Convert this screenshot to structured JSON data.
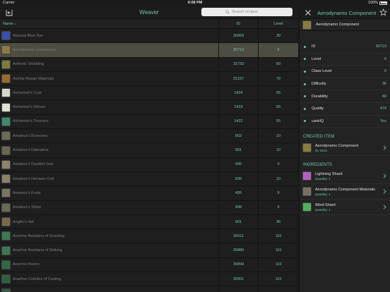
{
  "status_bar": {
    "carrier": "Carrier",
    "time": "4:08 PM",
    "battery": "100%"
  },
  "list": {
    "title": "Weaver",
    "search_placeholder": "Search recipes",
    "columns": {
      "name": "Name ↓",
      "id": "ID",
      "level": "Level"
    },
    "rows": [
      {
        "name": "Abyssal Blue Dye",
        "id": "30069",
        "level": "30",
        "icon_color": "#3a4fa8",
        "selected": false
      },
      {
        "name": "Aerodynamo Component",
        "id": "30719",
        "level": "6",
        "icon_color": "#8a7a40",
        "selected": true
      },
      {
        "name": "Aetheric Shielding",
        "id": "31733",
        "level": "50",
        "icon_color": "#7d7a3e",
        "selected": false
      },
      {
        "name": "Airship Repair Materials",
        "id": "31157",
        "level": "70",
        "icon_color": "#9a6a2a",
        "selected": false
      },
      {
        "name": "Alchemist's Coat",
        "id": "1424",
        "level": "55",
        "icon_color": "#d8d8c8",
        "selected": false
      },
      {
        "name": "Alchemist's Gloves",
        "id": "1423",
        "level": "55",
        "icon_color": "#e0e0d0",
        "selected": false
      },
      {
        "name": "Alchemist's Trousers",
        "id": "1422",
        "level": "55",
        "icon_color": "#3c8a6a",
        "selected": false
      },
      {
        "name": "Amateur's Breeches",
        "id": "502",
        "level": "10",
        "icon_color": "#6e6a58",
        "selected": false
      },
      {
        "name": "Amateur's Dalmatica",
        "id": "501",
        "level": "10",
        "icon_color": "#6a6650",
        "selected": false
      },
      {
        "name": "Amateur's Doublet Vest",
        "id": "496",
        "level": "9",
        "icon_color": "#8a8470",
        "selected": false
      },
      {
        "name": "Amateur's Hempen Coif",
        "id": "500",
        "level": "10",
        "icon_color": "#8c8068",
        "selected": false
      },
      {
        "name": "Amateur's Kurta",
        "id": "495",
        "level": "9",
        "icon_color": "#7a7460",
        "selected": false
      },
      {
        "name": "Amateur's Slops",
        "id": "498",
        "level": "9",
        "icon_color": "#6c6854",
        "selected": false
      },
      {
        "name": "Angler's Hat",
        "id": "601",
        "level": "36",
        "icon_color": "#7a6a4a",
        "selected": false
      },
      {
        "name": "Arachne Bandana of Scouting",
        "id": "30911",
        "level": "110",
        "icon_color": "#3c7a50",
        "selected": false
      },
      {
        "name": "Arachne Bandana of Striking",
        "id": "30880",
        "level": "110",
        "icon_color": "#3a7850",
        "selected": false
      },
      {
        "name": "Arachne Bolero",
        "id": "30899",
        "level": "110",
        "icon_color": "#2e6a48",
        "selected": false
      },
      {
        "name": "Arachne Culottes of Casting",
        "id": "30901",
        "level": "110",
        "icon_color": "#2c6040",
        "selected": false
      },
      {
        "name": "",
        "id": "",
        "level": "",
        "icon_color": "#2e5e40",
        "selected": false
      }
    ]
  },
  "detail": {
    "title": "Aerodynamo Component",
    "header_name": "Aerodynamo Component",
    "header_icon_color": "#8a7a40",
    "properties": [
      {
        "key": "ID",
        "value": "30719"
      },
      {
        "key": "Level",
        "value": "6"
      },
      {
        "key": "Class Level",
        "value": "6"
      },
      {
        "key": "Difficulty",
        "value": "36"
      },
      {
        "key": "Durability",
        "value": "60"
      },
      {
        "key": "Quality",
        "value": "474"
      },
      {
        "key": "canHQ",
        "value": "Yes"
      }
    ],
    "created_item_section": "CREATED ITEM",
    "created_item": {
      "name": "Aerodynamo Component",
      "sub": "ID: 8104",
      "icon_color": "#8a7a40"
    },
    "ingredients_section": "INGREDIENTS",
    "ingredients": [
      {
        "name": "Lightning Shard",
        "sub": "Quantity: 1",
        "icon_color": "#b060c0"
      },
      {
        "name": "Aerodynamo Component Materials",
        "sub": "Quantity: 1",
        "icon_color": "#7a7060"
      },
      {
        "name": "Wind Shard",
        "sub": "Quantity: 1",
        "icon_color": "#50b060"
      }
    ]
  },
  "colors": {
    "accent": "#6fc5b0",
    "selected_row": "#4d4d44",
    "background": "#1e1e1e"
  },
  "icons": {
    "back": "back-arrow-icon",
    "close": "close-icon",
    "favorite": "star-icon",
    "search": "search-icon",
    "chevron": "chevron-right-icon"
  }
}
